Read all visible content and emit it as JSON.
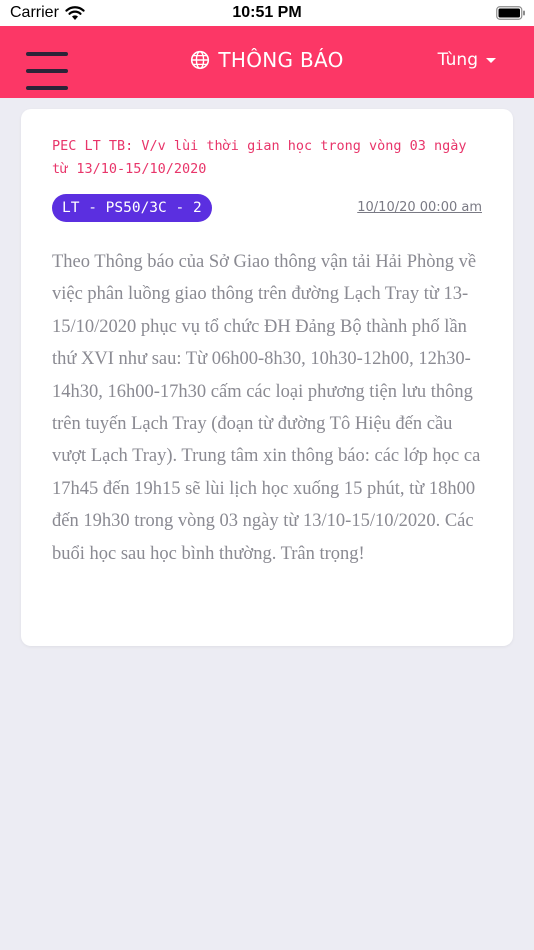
{
  "status_bar": {
    "carrier": "Carrier",
    "time": "10:51 PM"
  },
  "header": {
    "title": "THÔNG BÁO",
    "title_icon": "globe-icon",
    "menu_icon": "hamburger-menu-icon",
    "user_name": "Tùng",
    "user_caret_icon": "caret-down-icon",
    "background_color": "#fc3766"
  },
  "notice": {
    "title": "PEC LT TB: V/v lùi thời gian học trong vòng 03 ngày từ 13/10-15/10/2020",
    "class_badge": "LT - PS50/3C - 2",
    "date": "10/10/20 00:00 am",
    "body": "Theo Thông báo của Sở Giao thông vận tải Hải Phòng về việc phân luồng giao thông trên đường Lạch Tray từ 13-15/10/2020 phục vụ tổ chức ĐH Đảng Bộ thành phố lần thứ XVI như sau: Từ 06h00-8h30, 10h30-12h00, 12h30-14h30, 16h00-17h30 cấm các loại phương tiện lưu thông trên tuyến Lạch Tray (đoạn từ đường Tô Hiệu đến cầu vượt Lạch Tray). Trung tâm xin thông báo: các lớp học ca 17h45 đến 19h15 sẽ lùi lịch học xuống 15 phút, từ 18h00 đến 19h30 trong vòng 03 ngày từ 13/10-15/10/2020. Các buổi học sau học bình thường. Trân trọng!",
    "title_color": "#e8356a",
    "badge_color": "#5b2fe0"
  }
}
